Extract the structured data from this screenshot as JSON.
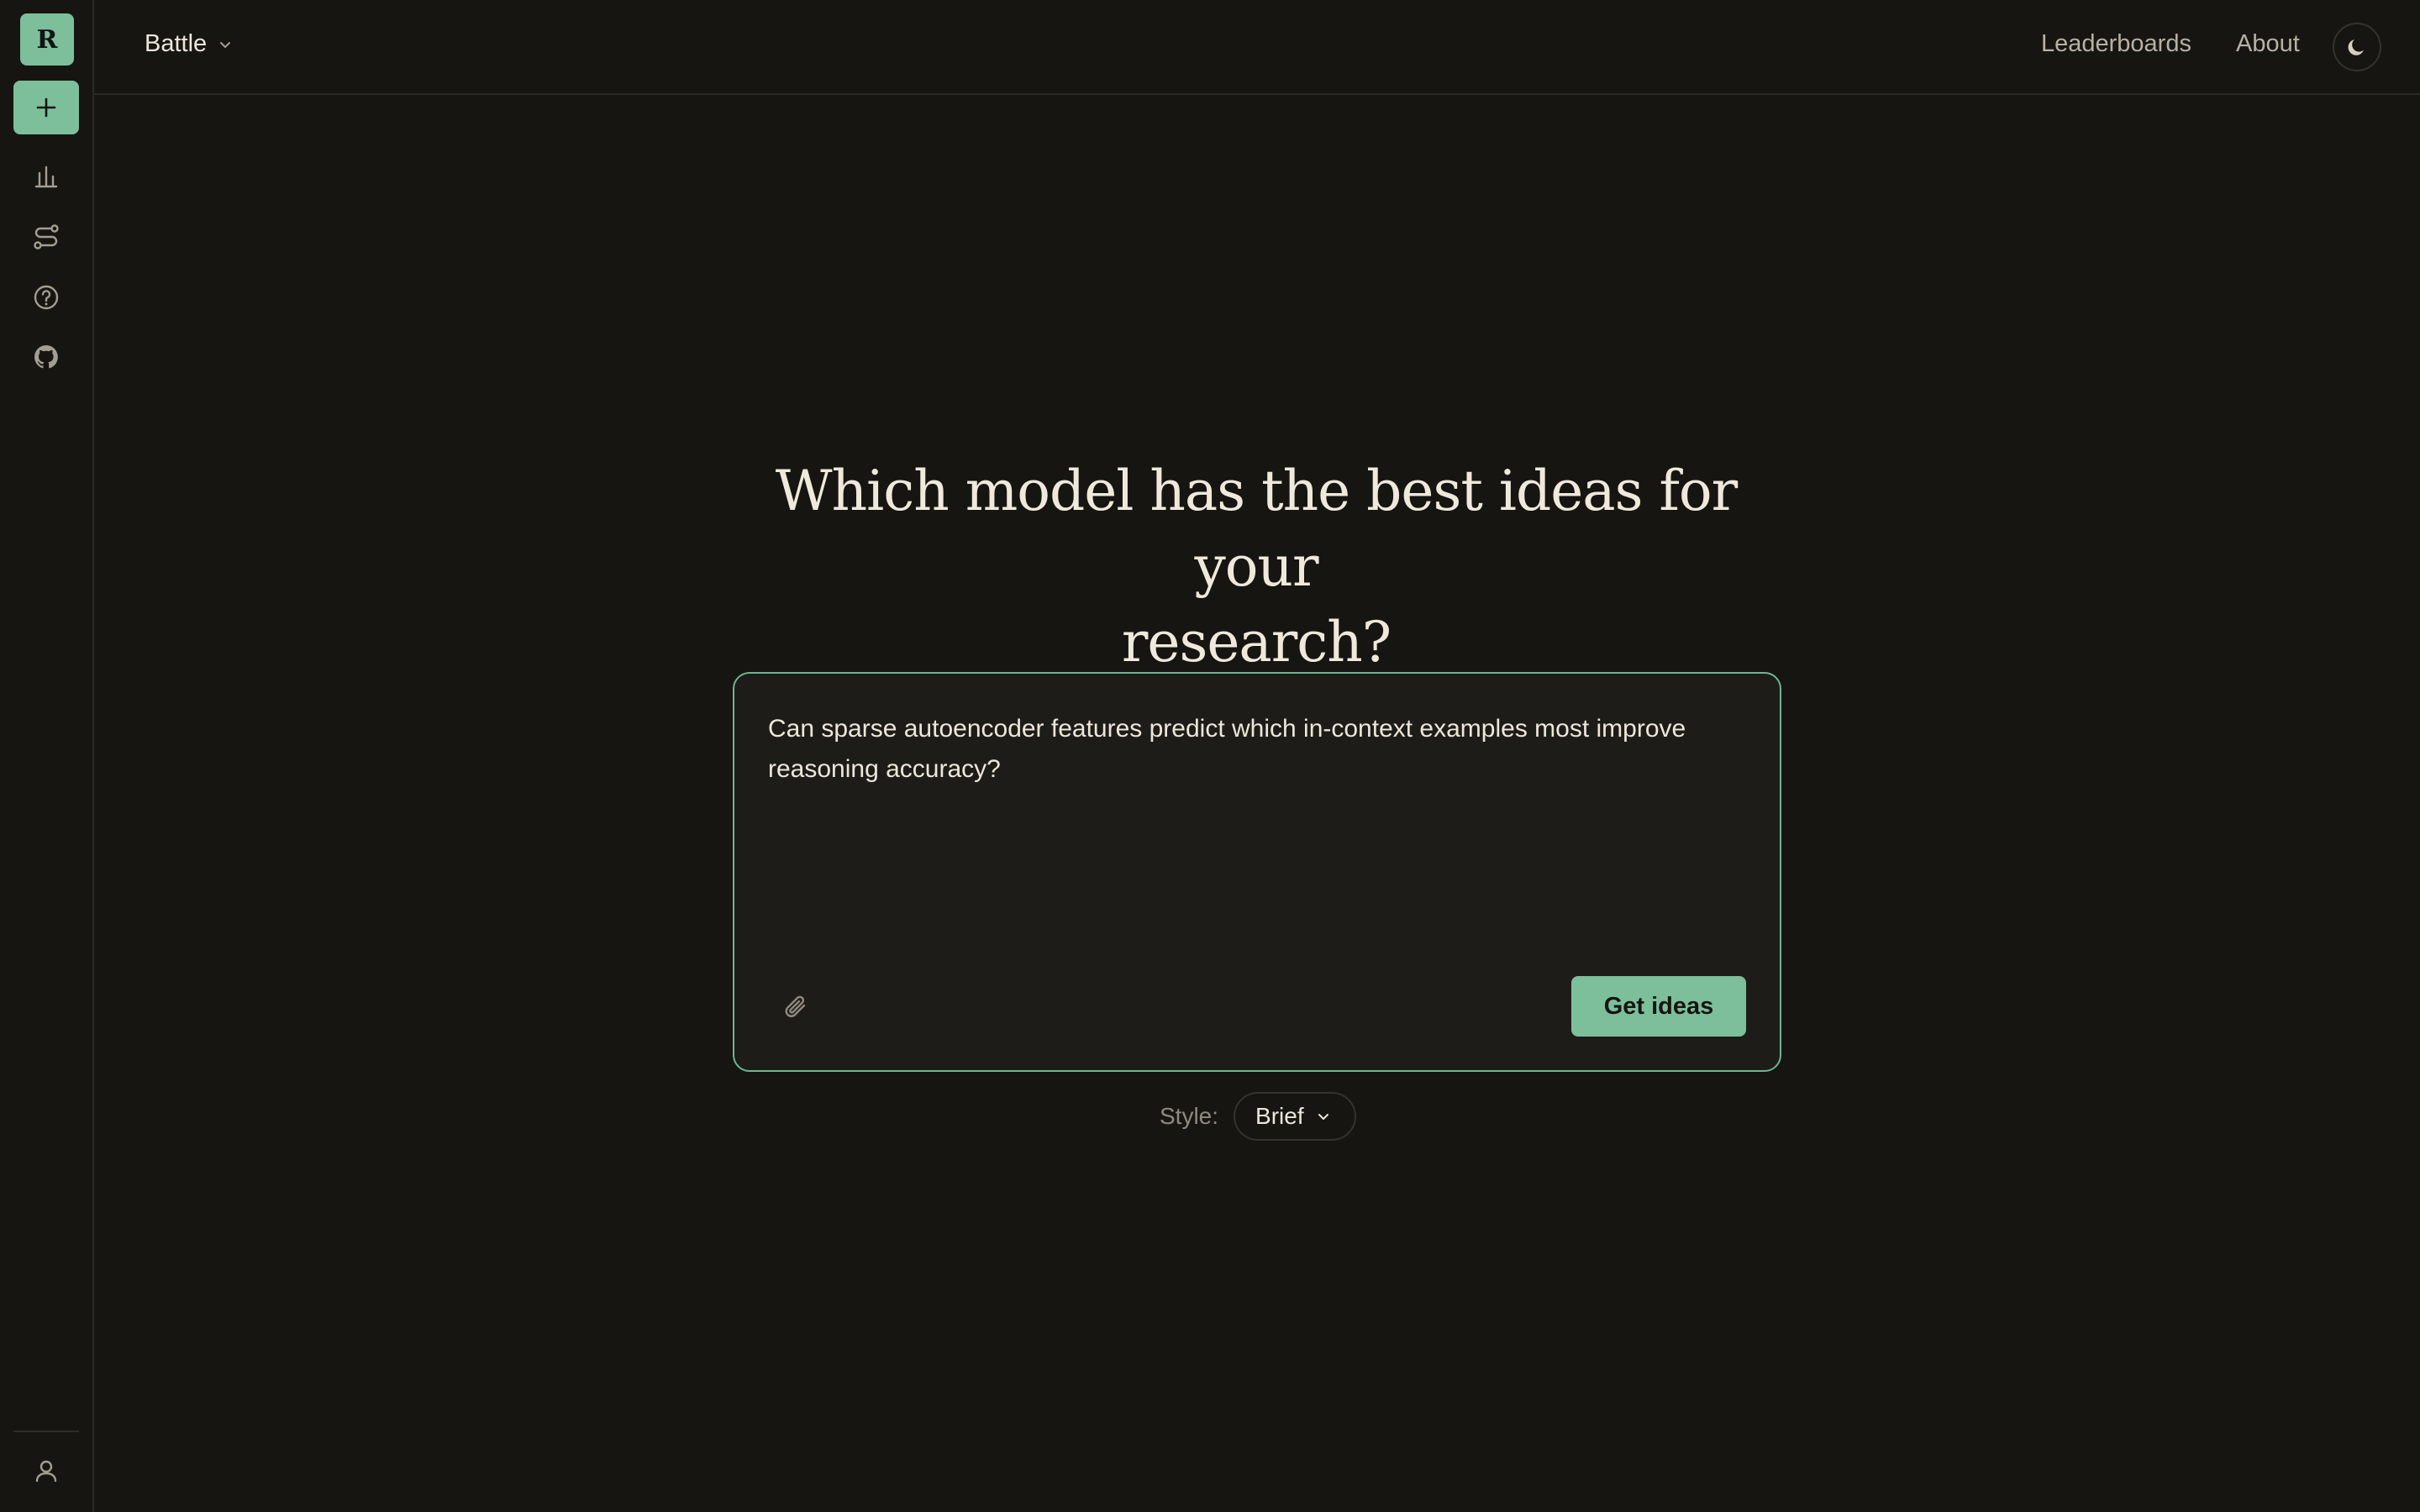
{
  "sidebar": {
    "logo_letter": "R",
    "items": [
      {
        "icon": "plus-icon",
        "label": "New battle"
      },
      {
        "icon": "bar-chart-icon",
        "label": "Leaderboards"
      },
      {
        "icon": "route-icon",
        "label": "Routes"
      },
      {
        "icon": "help-circle-icon",
        "label": "Help"
      },
      {
        "icon": "github-icon",
        "label": "GitHub"
      }
    ],
    "footer_icon": "user-icon"
  },
  "header": {
    "mode_label": "Battle",
    "nav": {
      "leaderboards": "Leaderboards",
      "about": "About"
    },
    "theme_icon": "moon-icon"
  },
  "main": {
    "headline_line1": "Which model has the best ideas for your",
    "headline_line2": "research?",
    "prompt_value": "Can sparse autoencoder features predict which in-context examples most improve reasoning accuracy?",
    "submit_label": "Get ideas",
    "attach_icon": "paperclip-icon",
    "style_label": "Style:",
    "style_value": "Brief"
  },
  "colors": {
    "background": "#161512",
    "accent": "#7dbf9b",
    "text": "#ece7db",
    "muted": "#b7b1a4"
  }
}
